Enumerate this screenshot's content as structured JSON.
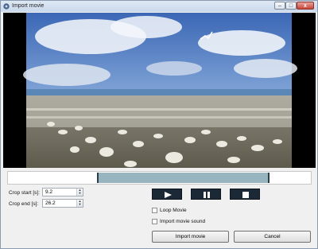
{
  "window": {
    "title": "Import movie",
    "minimize_label": "–",
    "maximize_label": "□",
    "close_label": "x"
  },
  "video": {
    "trim_start_fraction": 0.295,
    "trim_end_fraction": 0.865
  },
  "crop": {
    "start_label": "Crop start [s]:",
    "start_value": "9.2",
    "end_label": "Crop end [s]:",
    "end_value": "26.2"
  },
  "playback": {
    "play_icon": "play-icon",
    "pause_icon": "pause-icon",
    "stop_icon": "stop-icon"
  },
  "options": {
    "loop_label": "Loop Movie",
    "loop_checked": false,
    "sound_label": "Import movie sound",
    "sound_checked": false
  },
  "buttons": {
    "import_label": "Import movie",
    "cancel_label": "Cancel"
  },
  "colors": {
    "titlebar": "#c9d8ec",
    "trim_range": "#98b4be",
    "playback_button": "#1b2936"
  }
}
